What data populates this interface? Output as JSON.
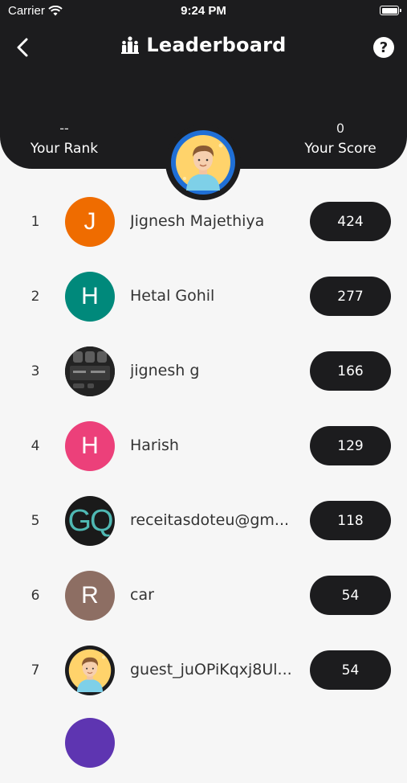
{
  "status_bar": {
    "carrier": "Carrier",
    "time": "9:24 PM"
  },
  "header": {
    "title": "Leaderboard",
    "help_label": "?",
    "your_rank": {
      "value": "--",
      "label": "Your Rank"
    },
    "your_score": {
      "value": "0",
      "label": "Your Score"
    }
  },
  "leaderboard": [
    {
      "rank": "1",
      "initial": "J",
      "name": "Jignesh Majethiya",
      "score": "424",
      "avatar_color": "#ef6c00"
    },
    {
      "rank": "2",
      "initial": "H",
      "name": "Hetal Gohil",
      "score": "277",
      "avatar_color": "#00897b"
    },
    {
      "rank": "3",
      "initial": "",
      "name": "jignesh g",
      "score": "166",
      "avatar_color": "#1e1e1e"
    },
    {
      "rank": "4",
      "initial": "H",
      "name": "Harish",
      "score": "129",
      "avatar_color": "#ec407a"
    },
    {
      "rank": "5",
      "initial": "GQ",
      "name": "receitasdoteu@gm...",
      "score": "118",
      "avatar_color": "#1a1a1a"
    },
    {
      "rank": "6",
      "initial": "R",
      "name": "car",
      "score": "54",
      "avatar_color": "#8d6e63"
    },
    {
      "rank": "7",
      "initial": "",
      "name": "guest_juOPiKqxj8Ul...",
      "score": "54",
      "avatar_color": "#1c1c1e"
    }
  ]
}
